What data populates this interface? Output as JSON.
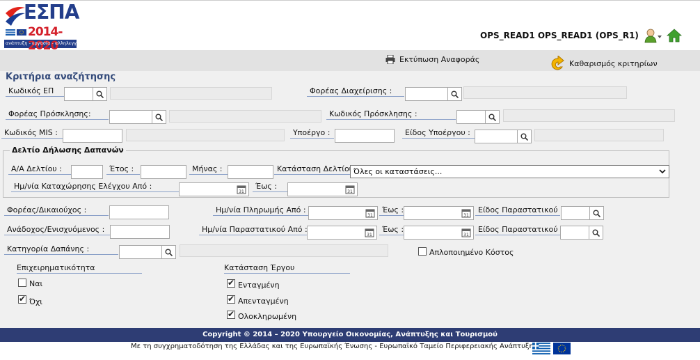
{
  "header": {
    "logo_title": "ΕΣΠΑ",
    "logo_years": "2014-2020",
    "logo_tagline": "ανάπτυξη - εργασία - αλληλεγγύη",
    "user": "OPS_READ1 OPS_READ1 (OPS_R1)"
  },
  "toolbar": {
    "print_label": "Εκτύπωση Αναφοράς",
    "clear_label": "Καθαρισμός κριτηρίων"
  },
  "search": {
    "title": "Κριτήρια αναζήτησης",
    "op_code": "Κωδικός ΕΠ",
    "managing_body": "Φορέας Διαχείρισης :",
    "call_body": "Φορέας Πρόσκλησης:",
    "call_code": "Κωδικός Πρόσκλησης :",
    "mis_code": "Κωδικός MIS :",
    "subproject": "Υποέργο :",
    "subproject_type": "Είδος Υποέργου :"
  },
  "declaration": {
    "legend": "Δελτίο Δήλωσης Δαπανών",
    "serial": "Α/Α Δελτίου :",
    "year": "Έτος :",
    "month": "Μήνας :",
    "status": "Κατάσταση Δελτίου",
    "status_value": "Όλες οι καταστάσεις...",
    "reg_date_from": "Ημ/νία Καταχώρησης Ελέγχου Από :",
    "reg_date_to": "Έως :"
  },
  "payments": {
    "beneficiary": "Φορέας/Δικαιούχος :",
    "pay_date_from": "Ημ/νία Πληρωμής Από :",
    "to1": "Έως :",
    "doc_type1": "Είδος Παραστατικού :",
    "contractor": "Ανάδοχος/Ενισχυόμενος :",
    "doc_date_from": "Ημ/νία Παραστατικού Από :",
    "to2": "Έως :",
    "doc_type2": "Είδος Παραστατικού :",
    "expense_category": "Κατηγορία Δαπάνης :",
    "simplified_cost": "Απλοποιημένο Κόστος"
  },
  "business": {
    "title": "Επιχειρηματικότητα",
    "yes": "Ναι",
    "no": "Όχι"
  },
  "project_status": {
    "title": "Κατάσταση Έργου",
    "integrated": "Ενταγμένη",
    "deintegrated": "Απενταγμένη",
    "completed": "Ολοκληρωμένη"
  },
  "footer": {
    "copyright": "Copyright © 2014 – 2020 Υπουργείο Οικονομίας, Ανάπτυξης και Τουρισμού",
    "cofunding": "Με τη συγχρηματοδότηση της Ελλάδας και της Ευρωπαϊκής Ένωσης - Ευρωπαϊκό Ταμείο Περιφερειακής Ανάπτυξης"
  },
  "colors": {
    "footer_bar": "#2e3d74",
    "title": "#334a7a",
    "logo_red": "#d4202a",
    "logo_blue": "#233e8b"
  }
}
